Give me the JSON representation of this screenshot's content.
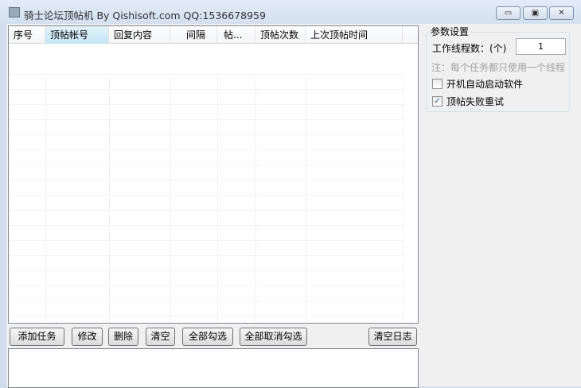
{
  "window": {
    "title": "骑士论坛顶帖机 By Qishisoft.com   QQ:1536678959",
    "minimize": "▭",
    "maximize": "▣",
    "close": "✕"
  },
  "table": {
    "columns": [
      "序号",
      "顶帖帐号",
      "回复内容",
      "间隔",
      "帖...",
      "顶帖次数",
      "上次顶帖时间"
    ]
  },
  "buttons": {
    "add": "添加任务",
    "edit": "修改",
    "delete": "删除",
    "clear": "清空",
    "select_all": "全部勾选",
    "deselect_all": "全部取消勾选",
    "clear_log": "清空日志"
  },
  "settings": {
    "group_title": "参数设置",
    "threads_label": "工作线程数：(个)",
    "threads_value": "1",
    "note": "注：每个任务都只使用一个线程",
    "autostart_label": "开机自动启动软件",
    "autostart_checked": false,
    "retry_label": "顶帖失败重试",
    "retry_checked": true
  }
}
